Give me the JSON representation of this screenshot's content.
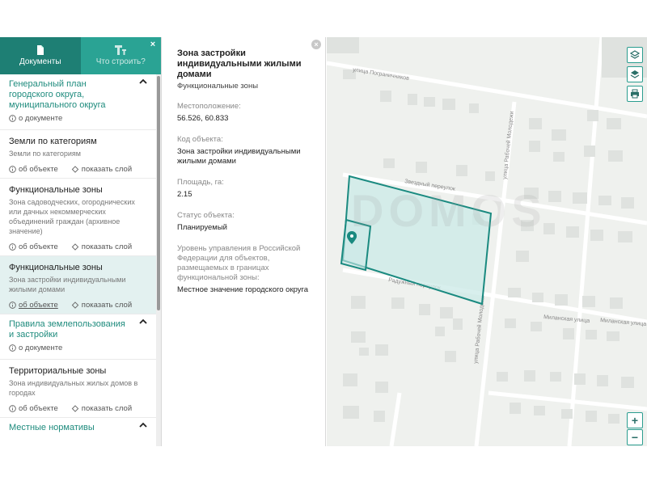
{
  "tabs": [
    {
      "label": "Документы",
      "icon": "document-icon",
      "active": true
    },
    {
      "label": "Что строить?",
      "icon": "text-format-icon",
      "active": false
    }
  ],
  "sections": [
    {
      "title": "Генеральный план городского округа, муниципального округа",
      "about": "о документе"
    },
    {
      "title": "Правила землепользования и застройки",
      "about": "о документе"
    },
    {
      "title": "Местные нормативы"
    }
  ],
  "items": [
    {
      "title": "Земли по категориям",
      "sub": "Земли по категориям",
      "about_object": "об объекте",
      "show_layer": "показать слой"
    },
    {
      "title": "Функциональные зоны",
      "sub": "Зона садоводческих, огороднических или дачных некоммерческих объединений граждан (архивное значение)",
      "about_object": "об объекте",
      "show_layer": "показать слой"
    },
    {
      "title": "Функциональные зоны",
      "sub": "Зона застройки индивидуальными жилыми домами",
      "about_object": "об объекте",
      "show_layer": "показать слой"
    },
    {
      "title": "Территориальные зоны",
      "sub": "Зона индивидуальных жилых домов в городах",
      "about_object": "об объекте",
      "show_layer": "показать слой"
    }
  ],
  "info": {
    "title": "Зона застройки индивидуальными жилыми домами",
    "subtitle": "Функциональные зоны",
    "fields": [
      {
        "label": "Местоположение:",
        "value": "56.526, 60.833"
      },
      {
        "label": "Код объекта:",
        "value": "Зона застройки индивидуальными жилыми домами"
      },
      {
        "label": "Площадь, га:",
        "value": "2.15"
      },
      {
        "label": "Статус объекта:",
        "value": "Планируемый"
      },
      {
        "label": "Уровень управления в Российской Федерации для объектов, размещаемых в границах функциональной зоны:",
        "value": "Местное значение городского округа"
      }
    ]
  },
  "map": {
    "streets": [
      "улица Пограничников",
      "Звездный переулок",
      "улица Рабочей Молодежи",
      "Радужный переулок",
      "Миланская улица",
      "Миланская улица",
      "улица Рабочей Молодежи"
    ],
    "watermark": "DOMOS",
    "zone_color": "#1a8a80",
    "zone_fill": "#cbe9e7",
    "buttons": {
      "layers": "layers-icon",
      "base_layers": "stack-icon",
      "print": "printer-icon",
      "zoom_in": "+",
      "zoom_out": "−"
    }
  },
  "colors": {
    "accent": "#1e7f74",
    "accent_light": "#2aa394",
    "link": "#1e8b7d",
    "selected_bg": "#e3f1f0"
  }
}
